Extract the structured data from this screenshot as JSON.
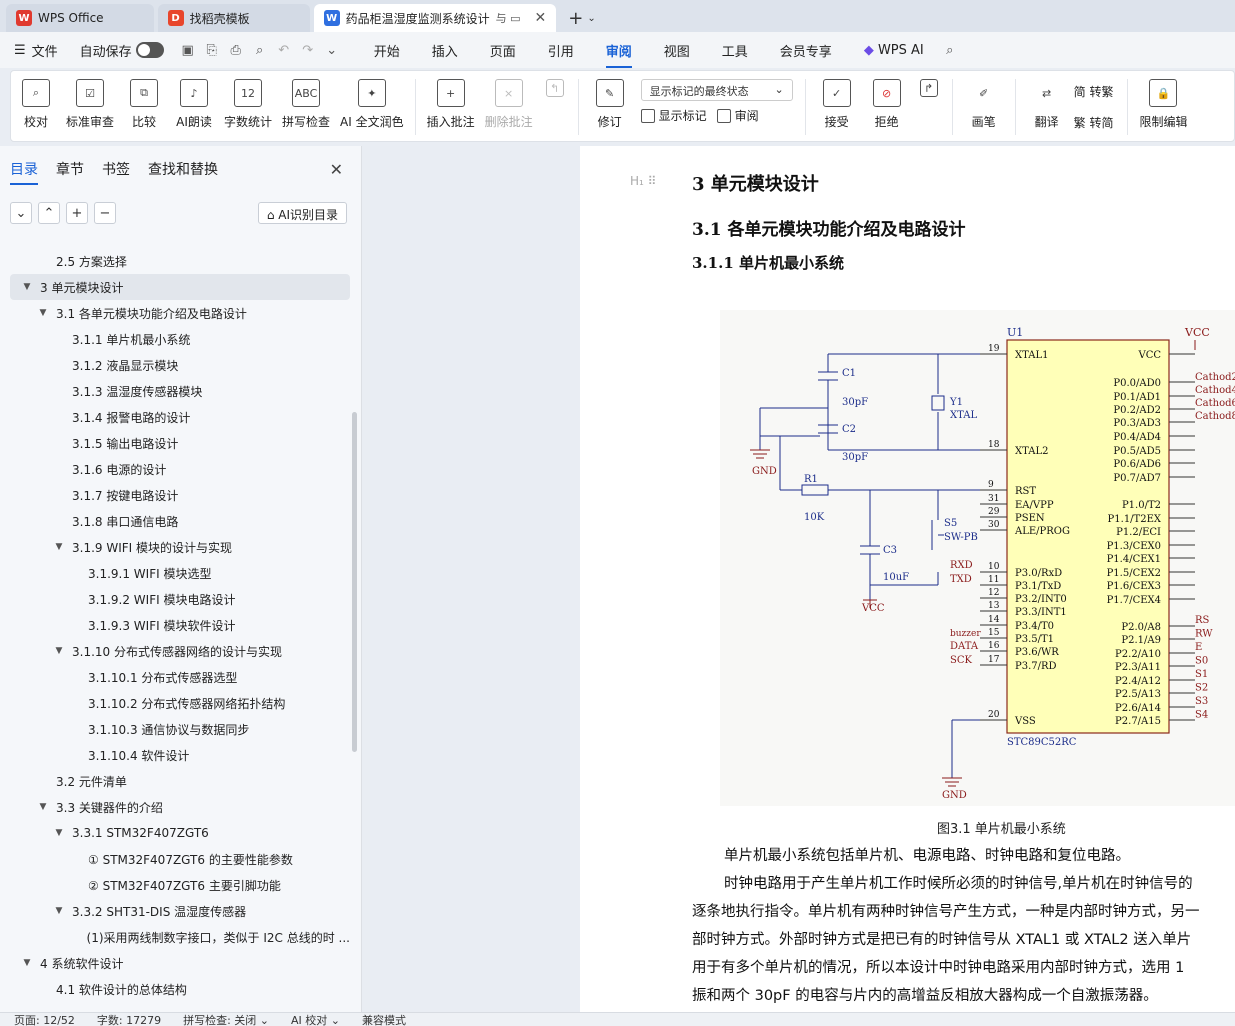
{
  "tabs": [
    {
      "label": "WPS Office",
      "logo": "W"
    },
    {
      "label": "找稻壳模板",
      "logo": "D"
    },
    {
      "label": "药品柜温湿度监测系统设计",
      "logo": "W"
    }
  ],
  "menu": {
    "file": "文件",
    "autosave": "自动保存",
    "tabs": [
      "开始",
      "插入",
      "页面",
      "引用",
      "审阅",
      "视图",
      "工具",
      "会员专享"
    ],
    "active": "审阅",
    "ai": "WPS AI"
  },
  "ribbon": {
    "groups1": [
      {
        "label": "校对",
        "icon": "proofread-icon"
      },
      {
        "label": "标准审查",
        "icon": "review-icon"
      },
      {
        "label": "比较",
        "icon": "compare-icon"
      },
      {
        "label": "AI朗读",
        "icon": "read-icon"
      },
      {
        "label": "字数统计",
        "icon": "wordcount-icon"
      },
      {
        "label": "拼写检查",
        "icon": "spell-icon"
      },
      {
        "label": "AI 全文润色",
        "icon": "polish-icon"
      }
    ],
    "insert_comment": "插入批注",
    "delete_comment": "删除批注",
    "revise": "修订",
    "select_state": "显示标记的最终状态",
    "show_marks": "显示标记",
    "review_pane": "审阅",
    "accept": "接受",
    "reject": "拒绝",
    "pen": "画笔",
    "translate": "翻译",
    "to_simplified": "简 转繁",
    "to_traditional": "繁 转简",
    "restrict": "限制编辑"
  },
  "panel": {
    "tabs": [
      "目录",
      "章节",
      "书签",
      "查找和替换"
    ],
    "ai_button": "AI识别目录",
    "toc": [
      {
        "text": "2.5  方案选择",
        "level": 2,
        "caret": ""
      },
      {
        "text": "3  单元模块设计",
        "level": 1,
        "caret": "▼",
        "sel": true
      },
      {
        "text": "3.1  各单元模块功能介绍及电路设计",
        "level": 2,
        "caret": "▼"
      },
      {
        "text": "3.1.1  单片机最小系统",
        "level": 3,
        "caret": ""
      },
      {
        "text": "3.1.2  液晶显示模块",
        "level": 3,
        "caret": ""
      },
      {
        "text": "3.1.3  温湿度传感器模块",
        "level": 3,
        "caret": ""
      },
      {
        "text": "3.1.4    报警电路的设计",
        "level": 3,
        "caret": ""
      },
      {
        "text": "3.1.5  输出电路设计",
        "level": 3,
        "caret": ""
      },
      {
        "text": "3.1.6  电源的设计",
        "level": 3,
        "caret": ""
      },
      {
        "text": "3.1.7    按键电路设计",
        "level": 3,
        "caret": ""
      },
      {
        "text": "3.1.8  串口通信电路",
        "level": 3,
        "caret": ""
      },
      {
        "text": "3.1.9 WIFI 模块的设计与实现",
        "level": 3,
        "caret": "▼"
      },
      {
        "text": "3.1.9.1 WIFI 模块选型",
        "level": 4,
        "caret": ""
      },
      {
        "text": "3.1.9.2 WIFI 模块电路设计",
        "level": 4,
        "caret": ""
      },
      {
        "text": "3.1.9.3 WIFI 模块软件设计",
        "level": 4,
        "caret": ""
      },
      {
        "text": "3.1.10  分布式传感器网络的设计与实现",
        "level": 3,
        "caret": "▼"
      },
      {
        "text": "3.1.10.1  分布式传感器选型",
        "level": 4,
        "caret": ""
      },
      {
        "text": "3.1.10.2  分布式传感器网络拓扑结构",
        "level": 4,
        "caret": ""
      },
      {
        "text": "3.1.10.3  通信协议与数据同步",
        "level": 4,
        "caret": ""
      },
      {
        "text": "3.1.10.4  软件设计",
        "level": 4,
        "caret": ""
      },
      {
        "text": "3.2  元件清单",
        "level": 2,
        "caret": ""
      },
      {
        "text": "3.3  关键器件的介绍",
        "level": 2,
        "caret": "▼"
      },
      {
        "text": "3.3.1 STM32F407ZGT6",
        "level": 3,
        "caret": "▼"
      },
      {
        "text": "① STM32F407ZGT6 的主要性能参数",
        "level": 4,
        "caret": ""
      },
      {
        "text": "② STM32F407ZGT6 主要引脚功能",
        "level": 4,
        "caret": ""
      },
      {
        "text": "3.3.2 SHT31-DIS 温湿度传感器",
        "level": 3,
        "caret": "▼"
      },
      {
        "text": "(1)采用两线制数字接口，类似于 I2C 总线的时 ...",
        "level": 4,
        "caret": ""
      },
      {
        "text": "4  系统软件设计",
        "level": 1,
        "caret": "▼"
      },
      {
        "text": "4.1  软件设计的总体结构",
        "level": 2,
        "caret": ""
      }
    ]
  },
  "doc": {
    "heading_mark": "H₁",
    "h1": "3  单元模块设计",
    "h2": "3.1  各单元模块功能介绍及电路设计",
    "h3": "3.1.1  单片机最小系统",
    "caption": "图3.1  单片机最小系统",
    "paragraphs": [
      "单片机最小系统包括单片机、电源电路、时钟电路和复位电路。",
      "时钟电路用于产生单片机工作时候所必须的时钟信号,单片机在时钟信号的",
      "逐条地执行指令。单片机有两种时钟信号产生方式，一种是内部时钟方式，另一",
      "部时钟方式。外部时钟方式是把已有的时钟信号从 XTAL1 或 XTAL2 送入单片",
      "用于有多个单片机的情况，所以本设计中时钟电路采用内部时钟方式，选用 1",
      "振和两个 30pF 的电容与片内的高增益反相放大器构成一个自激振荡器。"
    ],
    "schematic": {
      "chip": "U1",
      "vcc": "VCC",
      "gnd": "GND",
      "part": "STC89C52RC",
      "left_pins": [
        "XTAL1",
        "XTAL2",
        "RST",
        "EA/VPP",
        "PSEN",
        "ALE/PROG",
        "P3.0/RxD",
        "P3.1/TxD",
        "P3.2/INT0",
        "P3.3/INT1",
        "P3.4/T0",
        "P3.5/T1",
        "P3.6/WR",
        "P3.7/RD",
        "VSS"
      ],
      "right_pins": [
        "VCC",
        "P0.0/AD0",
        "P0.1/AD1",
        "P0.2/AD2",
        "P0.3/AD3",
        "P0.4/AD4",
        "P0.5/AD5",
        "P0.6/AD6",
        "P0.7/AD7",
        "P1.0/T2",
        "P1.1/T2EX",
        "P1.2/ECI",
        "P1.3/CEX0",
        "P1.4/CEX1",
        "P1.5/CEX2",
        "P1.6/CEX3",
        "P1.7/CEX4",
        "P2.0/A8",
        "P2.1/A9",
        "P2.2/A10",
        "P2.3/A11",
        "P2.4/A12",
        "P2.5/A13",
        "P2.6/A14",
        "P2.7/A15"
      ],
      "nets_right": [
        "Cathod2",
        "Cathod4",
        "Cathod6",
        "Cathod8"
      ],
      "nets_p2": [
        "RS",
        "RW",
        "E",
        "S0",
        "S1",
        "S2",
        "S3",
        "S4"
      ],
      "nets_left": [
        "RXD",
        "TXD",
        "buzzer",
        "DATA",
        "SCK"
      ],
      "c1": "C1",
      "c2": "C2",
      "c3": "C3",
      "cap": "30pF",
      "c3v": "10uF",
      "r1": "R1",
      "r1v": "10K",
      "y1": "Y1",
      "xtal": "XTAL",
      "s5": "S5",
      "swpb": "SW-PB"
    }
  },
  "status": {
    "page": "页面: 12/52",
    "words": "字数: 17279",
    "spell": "拼写检查: 关闭 ⌄",
    "ai": "AI 校对 ⌄",
    "compat": "兼容模式"
  }
}
